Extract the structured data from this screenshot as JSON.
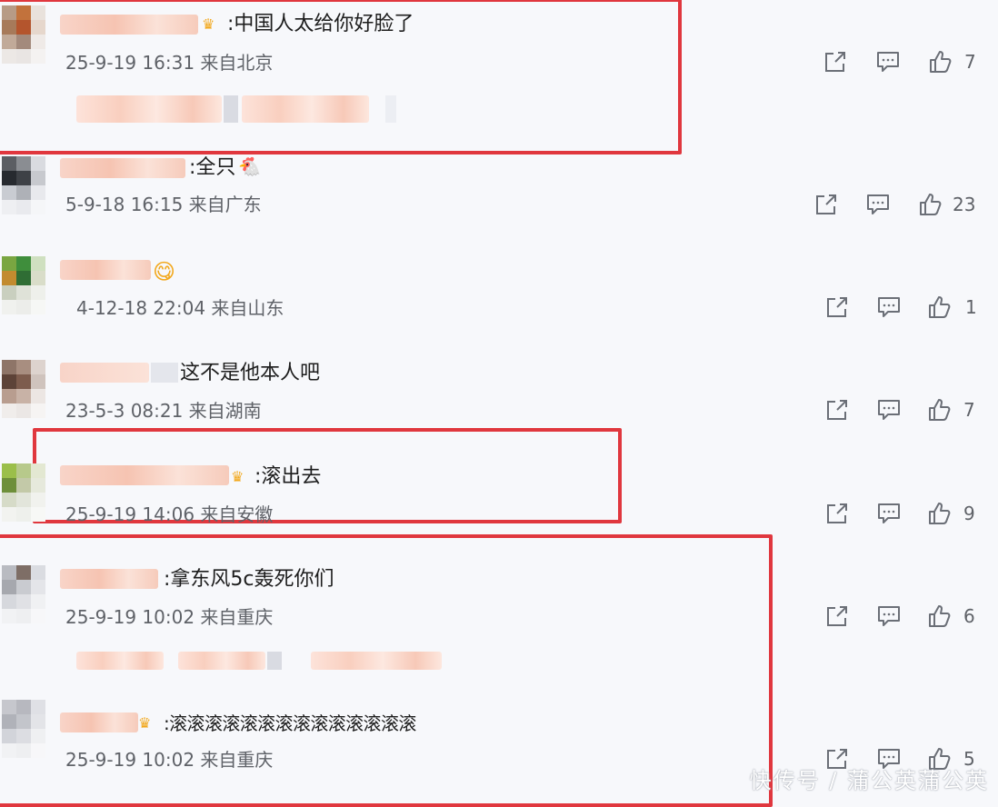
{
  "comments": [
    {
      "text": ":中国人太给你好脸了",
      "meta": "25-9-19 16:31 来自北京",
      "likes": "7"
    },
    {
      "text": ":全只",
      "meta": "5-9-18 16:15 来自广东",
      "likes": "23"
    },
    {
      "text": "",
      "meta": "4-12-18 22:04 来自山东",
      "likes": "1"
    },
    {
      "text": "这不是他本人吧",
      "meta": "23-5-3 08:21 来自湖南",
      "likes": "7"
    },
    {
      "text": ":滚出去",
      "meta": "25-9-19 14:06 来自安徽",
      "likes": "9"
    },
    {
      "text": ":拿东风5c轰死你们",
      "meta": "25-9-19 10:02 来自重庆",
      "likes": "6"
    },
    {
      "text": ":滚滚滚滚滚滚滚滚滚滚滚滚滚滚",
      "meta": "25-9-19 10:02 来自重庆",
      "likes": "5"
    }
  ],
  "watermark": "快传号 / 蒲公英蒲公英",
  "colors": {
    "highlight": "#e0373e",
    "meta_text": "#5f6268",
    "icon": "#6b6f77"
  },
  "icons": [
    "share-icon",
    "comment-icon",
    "like-icon",
    "crown-icon"
  ]
}
